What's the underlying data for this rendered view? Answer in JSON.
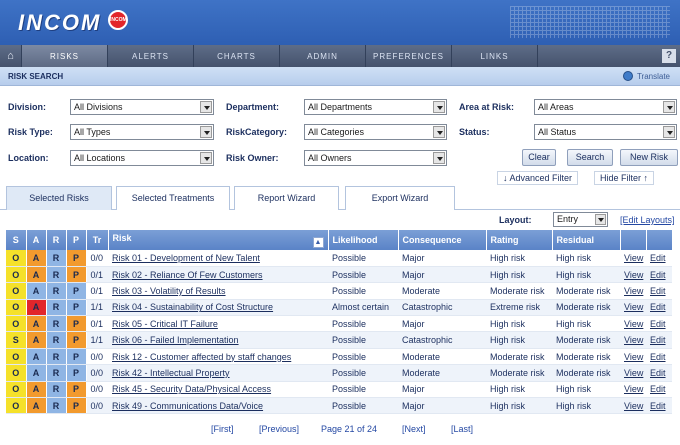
{
  "app": {
    "logo": "INCOM",
    "logo_badge": "INCOM"
  },
  "nav": {
    "items": [
      "RISKS",
      "ALERTS",
      "CHARTS",
      "ADMIN",
      "PREFERENCES",
      "LINKS"
    ],
    "help": "?"
  },
  "subbar": {
    "title": "RISK SEARCH",
    "translate": "Translate"
  },
  "filters": {
    "division_label": "Division:",
    "division_value": "All Divisions",
    "department_label": "Department:",
    "department_value": "All Departments",
    "area_label": "Area at Risk:",
    "area_value": "All Areas",
    "risktype_label": "Risk Type:",
    "risktype_value": "All Types",
    "category_label": "RiskCategory:",
    "category_value": "All Categories",
    "status_label": "Status:",
    "status_value": "All Status",
    "location_label": "Location:",
    "location_value": "All Locations",
    "owner_label": "Risk Owner:",
    "owner_value": "All Owners",
    "clear": "Clear",
    "search": "Search",
    "new_risk": "New Risk",
    "advanced": "↓  Advanced Filter",
    "hide": "Hide Filter ↑"
  },
  "tabs": [
    "Selected Risks",
    "Selected Treatments",
    "Report Wizard",
    "Export Wizard"
  ],
  "layout": {
    "label": "Layout:",
    "value": "Entry",
    "edit": "[Edit Layouts]"
  },
  "table": {
    "headers": [
      "S",
      "A",
      "R",
      "P",
      "Tr",
      "Risk",
      "Likelihood",
      "Consequence",
      "Rating",
      "Residual"
    ],
    "sort_icon": "▲",
    "view_label": "View",
    "edit_label": "Edit",
    "rows": [
      {
        "s": "O",
        "a": "A",
        "r": "R",
        "p": "P",
        "tr": "0/0",
        "risk": "Risk 01 - Development of New Talent",
        "lik": "Possible",
        "con": "Major",
        "rat": "High risk",
        "res": "High risk",
        "sc": "#f5e12a",
        "ac": "#f29a2e",
        "rc": "#8fb5e4",
        "pc": "#f29a2e"
      },
      {
        "s": "O",
        "a": "A",
        "r": "R",
        "p": "P",
        "tr": "0/1",
        "risk": "Risk 02 - Reliance Of Few Customers",
        "lik": "Possible",
        "con": "Major",
        "rat": "High risk",
        "res": "High risk",
        "sc": "#f5e12a",
        "ac": "#f29a2e",
        "rc": "#8fb5e4",
        "pc": "#f29a2e"
      },
      {
        "s": "O",
        "a": "A",
        "r": "R",
        "p": "P",
        "tr": "0/1",
        "risk": "Risk 03 - Volatility of Results",
        "lik": "Possible",
        "con": "Moderate",
        "rat": "Moderate risk",
        "res": "Moderate risk",
        "sc": "#f5e12a",
        "ac": "#8fb5e4",
        "rc": "#8fb5e4",
        "pc": "#8fb5e4"
      },
      {
        "s": "O",
        "a": "A",
        "r": "R",
        "p": "P",
        "tr": "1/1",
        "risk": "Risk 04 - Sustainability of Cost Structure",
        "lik": "Almost certain",
        "con": "Catastrophic",
        "rat": "Extreme risk",
        "res": "Moderate risk",
        "sc": "#f5e12a",
        "ac": "#e2262b",
        "rc": "#8fb5e4",
        "pc": "#8fb5e4"
      },
      {
        "s": "O",
        "a": "A",
        "r": "R",
        "p": "P",
        "tr": "0/1",
        "risk": "Risk 05 - Critical IT Failure",
        "lik": "Possible",
        "con": "Major",
        "rat": "High risk",
        "res": "High risk",
        "sc": "#f5e12a",
        "ac": "#f29a2e",
        "rc": "#8fb5e4",
        "pc": "#f29a2e"
      },
      {
        "s": "S",
        "a": "A",
        "r": "R",
        "p": "P",
        "tr": "1/1",
        "risk": "Risk 06 - Failed Implementation",
        "lik": "Possible",
        "con": "Catastrophic",
        "rat": "High risk",
        "res": "Moderate risk",
        "sc": "#f5e12a",
        "ac": "#f29a2e",
        "rc": "#8fb5e4",
        "pc": "#f29a2e"
      },
      {
        "s": "O",
        "a": "A",
        "r": "R",
        "p": "P",
        "tr": "0/0",
        "risk": "Risk 12 - Customer affected by staff changes",
        "lik": "Possible",
        "con": "Moderate",
        "rat": "Moderate risk",
        "res": "Moderate risk",
        "sc": "#f5e12a",
        "ac": "#8fb5e4",
        "rc": "#8fb5e4",
        "pc": "#8fb5e4"
      },
      {
        "s": "O",
        "a": "A",
        "r": "R",
        "p": "P",
        "tr": "0/0",
        "risk": "Risk 42 - Intellectual Property",
        "lik": "Possible",
        "con": "Moderate",
        "rat": "Moderate risk",
        "res": "Moderate risk",
        "sc": "#f5e12a",
        "ac": "#8fb5e4",
        "rc": "#8fb5e4",
        "pc": "#8fb5e4"
      },
      {
        "s": "O",
        "a": "A",
        "r": "R",
        "p": "P",
        "tr": "0/0",
        "risk": "Risk 45 - Security Data/Physical Access",
        "lik": "Possible",
        "con": "Major",
        "rat": "High risk",
        "res": "High risk",
        "sc": "#f5e12a",
        "ac": "#f29a2e",
        "rc": "#8fb5e4",
        "pc": "#f29a2e"
      },
      {
        "s": "O",
        "a": "A",
        "r": "R",
        "p": "P",
        "tr": "0/0",
        "risk": "Risk 49 - Communications Data/Voice",
        "lik": "Possible",
        "con": "Major",
        "rat": "High risk",
        "res": "High risk",
        "sc": "#f5e12a",
        "ac": "#f29a2e",
        "rc": "#8fb5e4",
        "pc": "#f29a2e"
      }
    ]
  },
  "pager": {
    "first": "[First]",
    "previous": "[Previous]",
    "page": "Page 21 of 24",
    "next": "[Next]",
    "last": "[Last]"
  }
}
